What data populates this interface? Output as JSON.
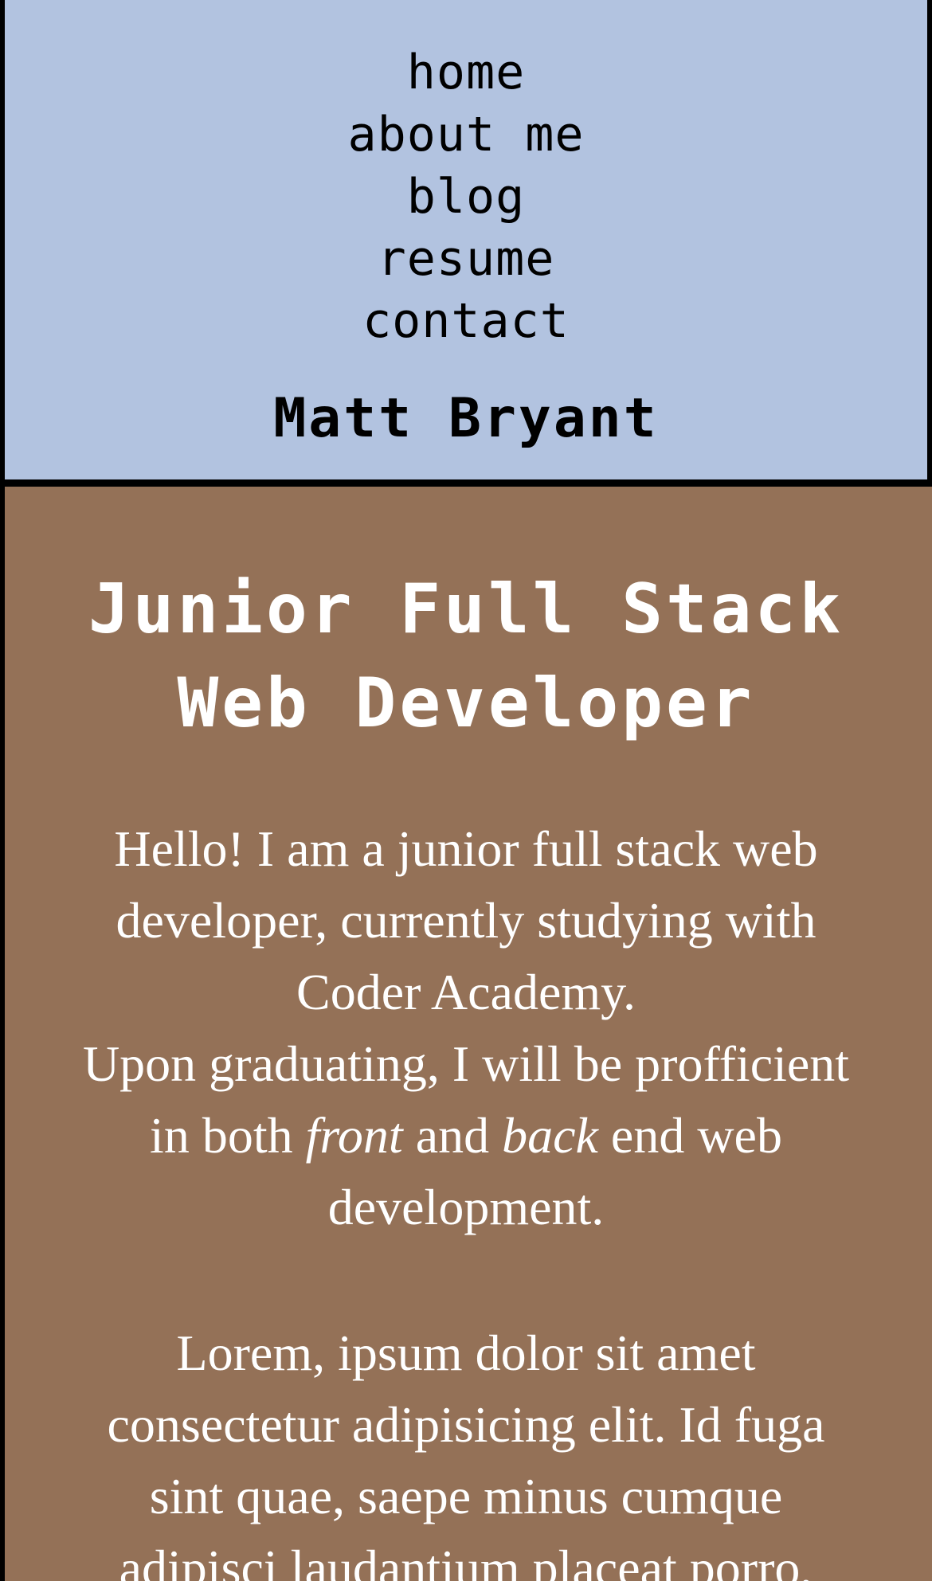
{
  "nav": {
    "items": [
      {
        "label": "home"
      },
      {
        "label": "about me"
      },
      {
        "label": "blog"
      },
      {
        "label": "resume"
      },
      {
        "label": "contact"
      }
    ],
    "site_name": "Matt Bryant"
  },
  "main": {
    "title_line1": "Junior Full Stack",
    "title_line2": "Web Developer",
    "intro": {
      "line1": "Hello! I am a junior full stack web developer, currently studying with Coder Academy.",
      "line2_before_front": "Upon graduating, I will be profficient in both ",
      "front": "front",
      "between": " and ",
      "back": "back",
      "after_back": " end web development."
    },
    "lorem": "Lorem, ipsum dolor sit amet consectetur adipisicing elit. Id fuga sint quae, saepe minus cumque adipisci laudantium placeat porro,"
  },
  "colors": {
    "header_bg": "#b2c3e0",
    "main_bg": "#947157",
    "border": "#000000",
    "text_light": "#ffffff"
  }
}
